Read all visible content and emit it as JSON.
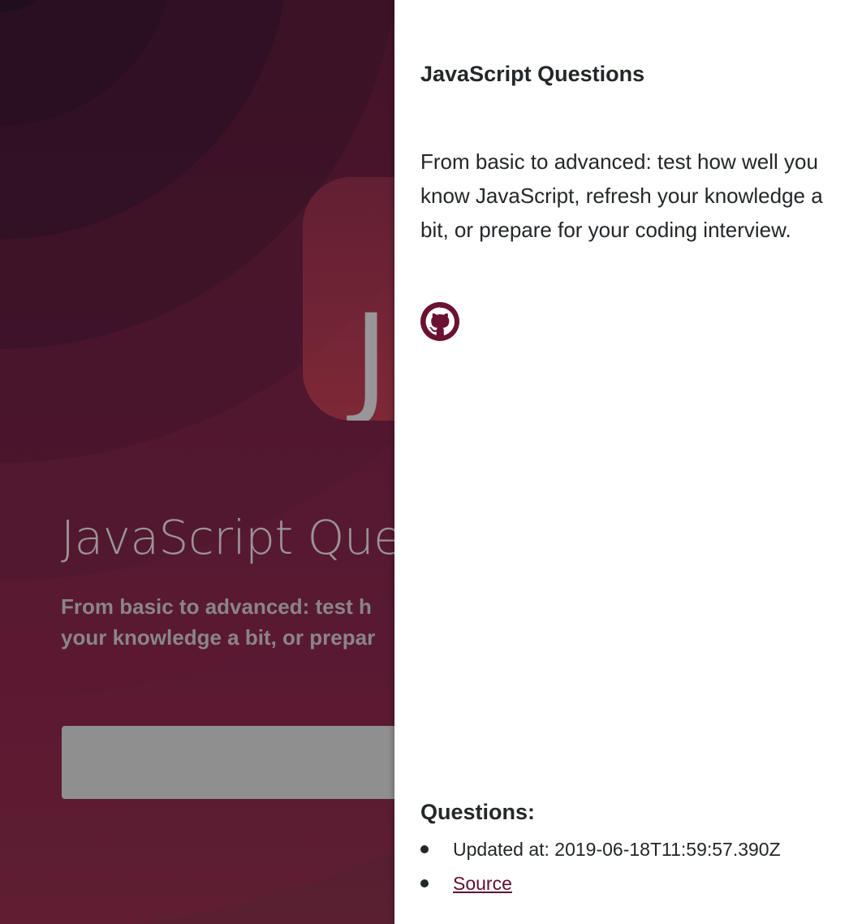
{
  "background": {
    "logo_letter": "J",
    "title": "JavaScript Ques",
    "description_lines": [
      "From basic to advanced: test h",
      "your knowledge a bit, or prepar"
    ]
  },
  "drawer": {
    "title": "JavaScript Questions",
    "description": "From basic to advanced: test how well you know JavaScript, refresh your knowledge a bit, or prepare for your coding interview.",
    "github_icon": "github-icon",
    "questions": {
      "heading": "Questions:",
      "updated_label": "Updated at: 2019-06-18T11:59:57.390Z",
      "source_label": "Source"
    }
  },
  "colors": {
    "accent": "#6b1232",
    "text": "#24272a",
    "link": "#5e0f2e"
  }
}
